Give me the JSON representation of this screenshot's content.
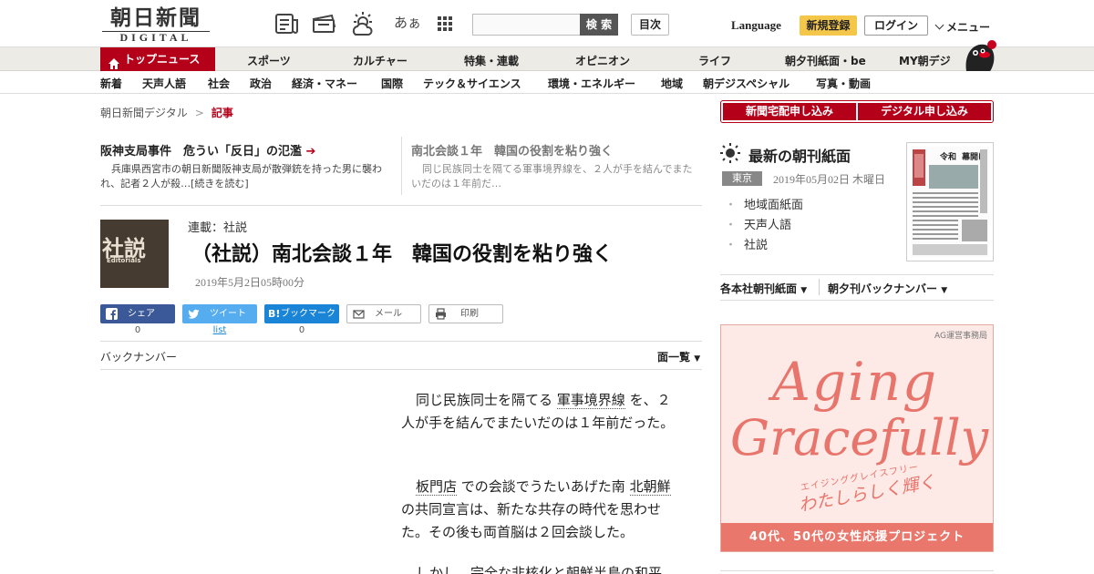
{
  "header": {
    "logo_jp": "朝日新聞",
    "logo_en": "DIGITAL",
    "search_button": "検 索",
    "index_button": "目次",
    "language": "Language",
    "register": "新規登録",
    "login": "ログイン",
    "menu": "メニュー",
    "font_toggle": "あぁ",
    "icons": [
      "newspaper-icon",
      "coupon-icon",
      "weather-icon",
      "font-size-icon",
      "apps-grid-icon"
    ]
  },
  "nav_primary": [
    "トップニュース",
    "スポーツ",
    "カルチャー",
    "特集・連載",
    "オピニオン",
    "ライフ",
    "朝夕刊紙面・be",
    "MY朝デジ"
  ],
  "nav_secondary": [
    "新着",
    "天声人語",
    "社会",
    "政治",
    "経済・マネー",
    "国際",
    "テック＆サイエンス",
    "環境・エネルギー",
    "地域",
    "朝デジスペシャル",
    "写真・動画"
  ],
  "breadcrumb": {
    "home": "朝日新聞デジタル",
    "sep": ">",
    "current": "記事"
  },
  "related": [
    {
      "title": "阪神支局事件　危うい「反日」の氾濫",
      "body": "兵庫県西宮市の朝日新聞阪神支局が散弾銃を持った男に襲われ、記者２人が殺…[続きを読む]"
    },
    {
      "title": "南北会談１年　韓国の役割を粘り強く",
      "body": "同じ民族同士を隔てる軍事境界線を、２人が手を結んでまたいだのは１年前だ…"
    }
  ],
  "article": {
    "thumb_kanji": "社説",
    "thumb_en": "Editorials",
    "series": "連載：社説",
    "title": "（社説）南北会談１年　韓国の役割を粘り強く",
    "date": "2019年5月2日05時00分"
  },
  "share": {
    "facebook": "シェア",
    "facebook_count": "0",
    "twitter": "ツイート",
    "twitter_count": "list",
    "hatena": "ブックマーク",
    "hatena_count": "0",
    "mail": "メール",
    "print": "印刷"
  },
  "backnumber": "バックナンバー",
  "page_list": "面一覧",
  "body": {
    "p1_a": "同じ民族同士を隔てる",
    "p1_link": "軍事境界線",
    "p1_b": "を、２人が手を結んでまたいだのは１年前だった。",
    "p2_link1": "板門店",
    "p2_a": "での会談でうたいあげた南",
    "p2_link2": "北朝鮮",
    "p2_b": "の共同宣言は、新たな共存の時代を思わせた。その後も両首脳は２回会談した。",
    "p3": "しかし、完全な非核化と朝鮮半島の和平"
  },
  "sidebar": {
    "sub_paper": "新聞宅配申し込み",
    "sub_digital": "デジタル申し込み",
    "morning_title": "最新の朝刊紙面",
    "region": "東京",
    "morning_date": "2019年05月02日 木曜日",
    "links": [
      "地域面紙面",
      "天声人語",
      "社説"
    ],
    "dd_paper": "各本社朝刊紙面",
    "dd_back": "朝夕刊バックナンバー",
    "paper_head1": "令和",
    "paper_head2": "幕開け"
  },
  "ad": {
    "owner": "AG運営事務局",
    "line1": "Aging",
    "line2": "Gracefully",
    "kana": "エイジンググレイスフリー",
    "tagline": "わたしらしく輝く",
    "footer": "40代、50代の女性応援プロジェクト"
  },
  "colors": {
    "brand_red": "#b5001a",
    "register_yellow": "#f4c64a",
    "ad_coral": "#e8756c"
  }
}
